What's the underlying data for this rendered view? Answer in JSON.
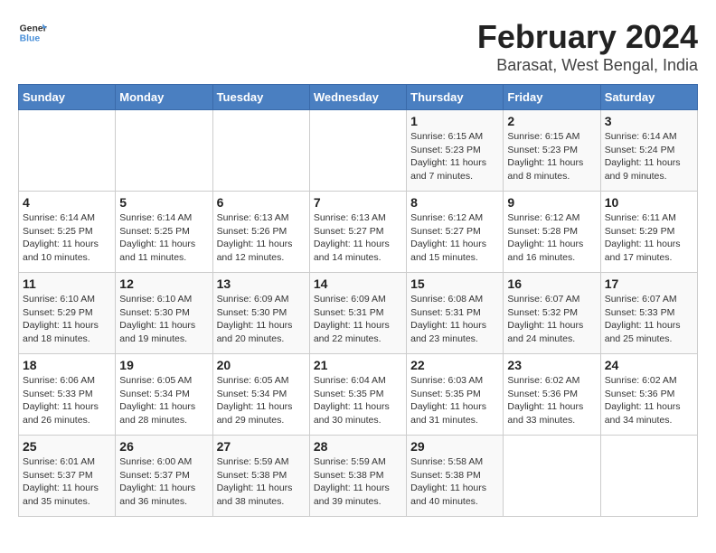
{
  "logo": {
    "general": "General",
    "blue": "Blue"
  },
  "title": "February 2024",
  "subtitle": "Barasat, West Bengal, India",
  "headers": [
    "Sunday",
    "Monday",
    "Tuesday",
    "Wednesday",
    "Thursday",
    "Friday",
    "Saturday"
  ],
  "weeks": [
    [
      {
        "day": "",
        "info": ""
      },
      {
        "day": "",
        "info": ""
      },
      {
        "day": "",
        "info": ""
      },
      {
        "day": "",
        "info": ""
      },
      {
        "day": "1",
        "info": "Sunrise: 6:15 AM\nSunset: 5:23 PM\nDaylight: 11 hours\nand 7 minutes."
      },
      {
        "day": "2",
        "info": "Sunrise: 6:15 AM\nSunset: 5:23 PM\nDaylight: 11 hours\nand 8 minutes."
      },
      {
        "day": "3",
        "info": "Sunrise: 6:14 AM\nSunset: 5:24 PM\nDaylight: 11 hours\nand 9 minutes."
      }
    ],
    [
      {
        "day": "4",
        "info": "Sunrise: 6:14 AM\nSunset: 5:25 PM\nDaylight: 11 hours\nand 10 minutes."
      },
      {
        "day": "5",
        "info": "Sunrise: 6:14 AM\nSunset: 5:25 PM\nDaylight: 11 hours\nand 11 minutes."
      },
      {
        "day": "6",
        "info": "Sunrise: 6:13 AM\nSunset: 5:26 PM\nDaylight: 11 hours\nand 12 minutes."
      },
      {
        "day": "7",
        "info": "Sunrise: 6:13 AM\nSunset: 5:27 PM\nDaylight: 11 hours\nand 14 minutes."
      },
      {
        "day": "8",
        "info": "Sunrise: 6:12 AM\nSunset: 5:27 PM\nDaylight: 11 hours\nand 15 minutes."
      },
      {
        "day": "9",
        "info": "Sunrise: 6:12 AM\nSunset: 5:28 PM\nDaylight: 11 hours\nand 16 minutes."
      },
      {
        "day": "10",
        "info": "Sunrise: 6:11 AM\nSunset: 5:29 PM\nDaylight: 11 hours\nand 17 minutes."
      }
    ],
    [
      {
        "day": "11",
        "info": "Sunrise: 6:10 AM\nSunset: 5:29 PM\nDaylight: 11 hours\nand 18 minutes."
      },
      {
        "day": "12",
        "info": "Sunrise: 6:10 AM\nSunset: 5:30 PM\nDaylight: 11 hours\nand 19 minutes."
      },
      {
        "day": "13",
        "info": "Sunrise: 6:09 AM\nSunset: 5:30 PM\nDaylight: 11 hours\nand 20 minutes."
      },
      {
        "day": "14",
        "info": "Sunrise: 6:09 AM\nSunset: 5:31 PM\nDaylight: 11 hours\nand 22 minutes."
      },
      {
        "day": "15",
        "info": "Sunrise: 6:08 AM\nSunset: 5:31 PM\nDaylight: 11 hours\nand 23 minutes."
      },
      {
        "day": "16",
        "info": "Sunrise: 6:07 AM\nSunset: 5:32 PM\nDaylight: 11 hours\nand 24 minutes."
      },
      {
        "day": "17",
        "info": "Sunrise: 6:07 AM\nSunset: 5:33 PM\nDaylight: 11 hours\nand 25 minutes."
      }
    ],
    [
      {
        "day": "18",
        "info": "Sunrise: 6:06 AM\nSunset: 5:33 PM\nDaylight: 11 hours\nand 26 minutes."
      },
      {
        "day": "19",
        "info": "Sunrise: 6:05 AM\nSunset: 5:34 PM\nDaylight: 11 hours\nand 28 minutes."
      },
      {
        "day": "20",
        "info": "Sunrise: 6:05 AM\nSunset: 5:34 PM\nDaylight: 11 hours\nand 29 minutes."
      },
      {
        "day": "21",
        "info": "Sunrise: 6:04 AM\nSunset: 5:35 PM\nDaylight: 11 hours\nand 30 minutes."
      },
      {
        "day": "22",
        "info": "Sunrise: 6:03 AM\nSunset: 5:35 PM\nDaylight: 11 hours\nand 31 minutes."
      },
      {
        "day": "23",
        "info": "Sunrise: 6:02 AM\nSunset: 5:36 PM\nDaylight: 11 hours\nand 33 minutes."
      },
      {
        "day": "24",
        "info": "Sunrise: 6:02 AM\nSunset: 5:36 PM\nDaylight: 11 hours\nand 34 minutes."
      }
    ],
    [
      {
        "day": "25",
        "info": "Sunrise: 6:01 AM\nSunset: 5:37 PM\nDaylight: 11 hours\nand 35 minutes."
      },
      {
        "day": "26",
        "info": "Sunrise: 6:00 AM\nSunset: 5:37 PM\nDaylight: 11 hours\nand 36 minutes."
      },
      {
        "day": "27",
        "info": "Sunrise: 5:59 AM\nSunset: 5:38 PM\nDaylight: 11 hours\nand 38 minutes."
      },
      {
        "day": "28",
        "info": "Sunrise: 5:59 AM\nSunset: 5:38 PM\nDaylight: 11 hours\nand 39 minutes."
      },
      {
        "day": "29",
        "info": "Sunrise: 5:58 AM\nSunset: 5:38 PM\nDaylight: 11 hours\nand 40 minutes."
      },
      {
        "day": "",
        "info": ""
      },
      {
        "day": "",
        "info": ""
      }
    ]
  ]
}
